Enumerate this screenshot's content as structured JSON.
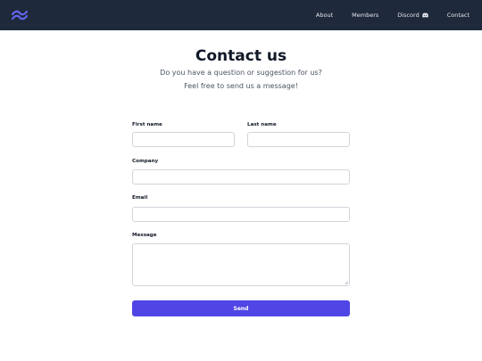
{
  "nav": {
    "items": [
      {
        "label": "About"
      },
      {
        "label": "Members"
      },
      {
        "label": "Discord"
      },
      {
        "label": "Contact"
      }
    ]
  },
  "hero": {
    "title": "Contact us",
    "subtitle_line1": "Do you have a question or suggestion for us?",
    "subtitle_line2": "Feel free to send us a message!"
  },
  "form": {
    "first_name_label": "First name",
    "first_name_value": "",
    "last_name_label": "Last name",
    "last_name_value": "",
    "company_label": "Company",
    "company_value": "",
    "email_label": "Email",
    "email_value": "",
    "message_label": "Message",
    "message_value": "",
    "send_label": "Send"
  },
  "colors": {
    "header_bg": "#1e293b",
    "accent": "#4f46e5",
    "logo": "#6366f1"
  },
  "icons": {
    "logo": "tailwind-wave-logo-icon",
    "discord": "discord-icon"
  }
}
